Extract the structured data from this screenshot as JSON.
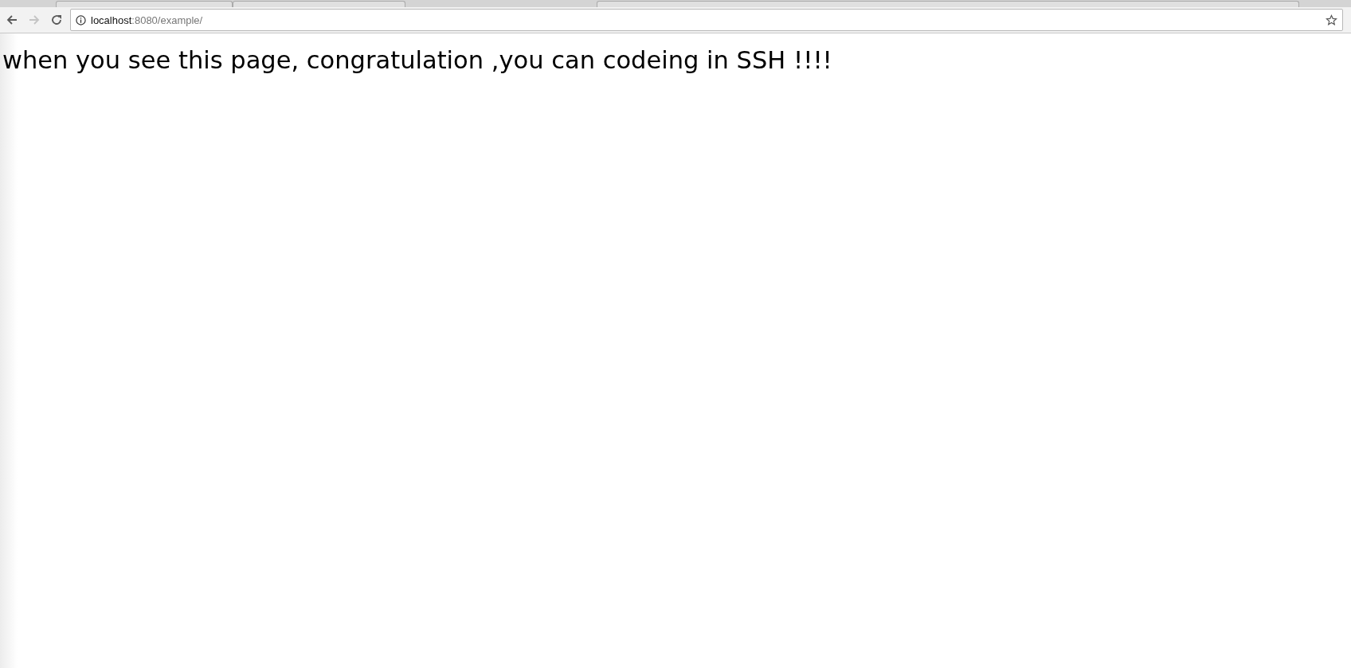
{
  "address_bar": {
    "host": "localhost",
    "path": ":8080/example/"
  },
  "navigation": {
    "back_disabled": false,
    "forward_disabled": true
  },
  "page": {
    "heading": "when you see this page, congratulation ,you can codeing in SSH !!!!"
  }
}
